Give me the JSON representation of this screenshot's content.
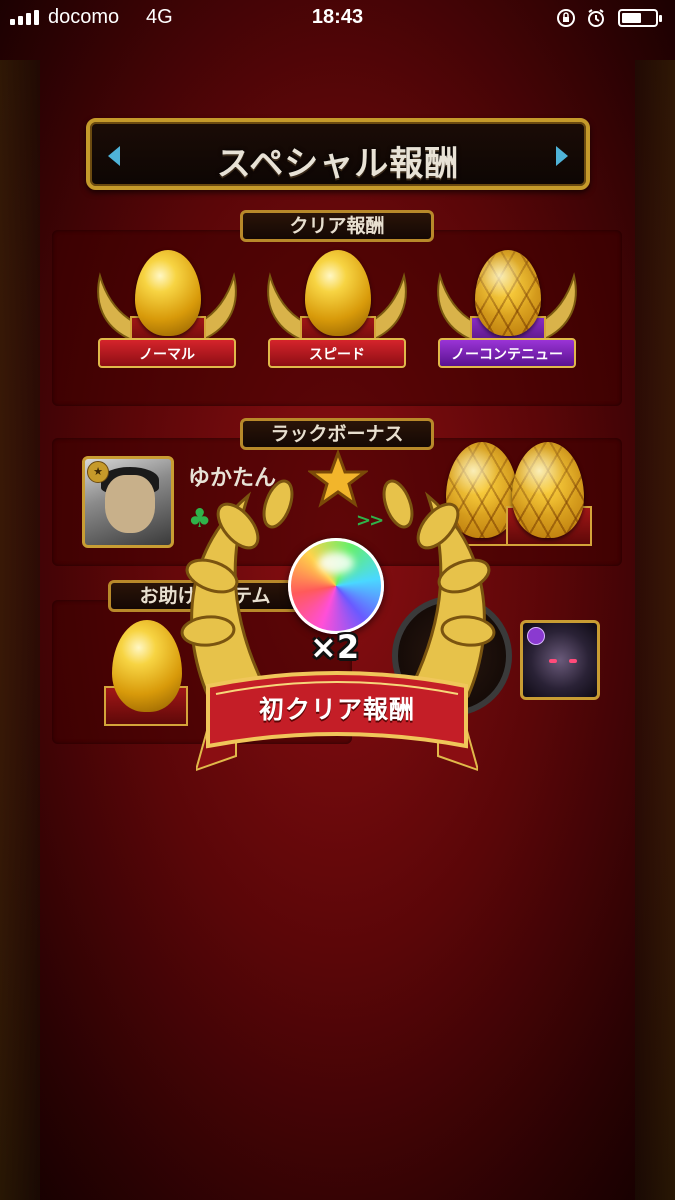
{
  "status_bar": {
    "carrier": "docomo",
    "network": "4G",
    "time": "18:43",
    "signal_bars": 4,
    "battery_level": 0.6,
    "icons": [
      "signal-icon",
      "rotation-lock-icon",
      "alarm-icon",
      "battery-icon"
    ]
  },
  "title": "スペシャル報酬",
  "clear_reward": {
    "label": "クリア報酬",
    "items": [
      {
        "label": "ノーマル",
        "egg": "gold-egg",
        "ribbon_color": "#c41e27"
      },
      {
        "label": "スピード",
        "egg": "gold-egg",
        "ribbon_color": "#c41e27"
      },
      {
        "label": "ノーコンテニュー",
        "egg": "hex-gold-egg",
        "ribbon_color": "#8a2cc6"
      }
    ]
  },
  "luck_bonus": {
    "label": "ラックボーナス",
    "username": "ゆかたん",
    "arrows": ">>"
  },
  "helper_items": {
    "label": "お助けアイテム"
  },
  "overlay": {
    "multiplier": "×2",
    "banner": "初クリア報酬",
    "item": "rainbow-orb"
  },
  "colors": {
    "gold": "#c59a2b",
    "background": "#6a080b",
    "banner_red": "#c41e27"
  }
}
